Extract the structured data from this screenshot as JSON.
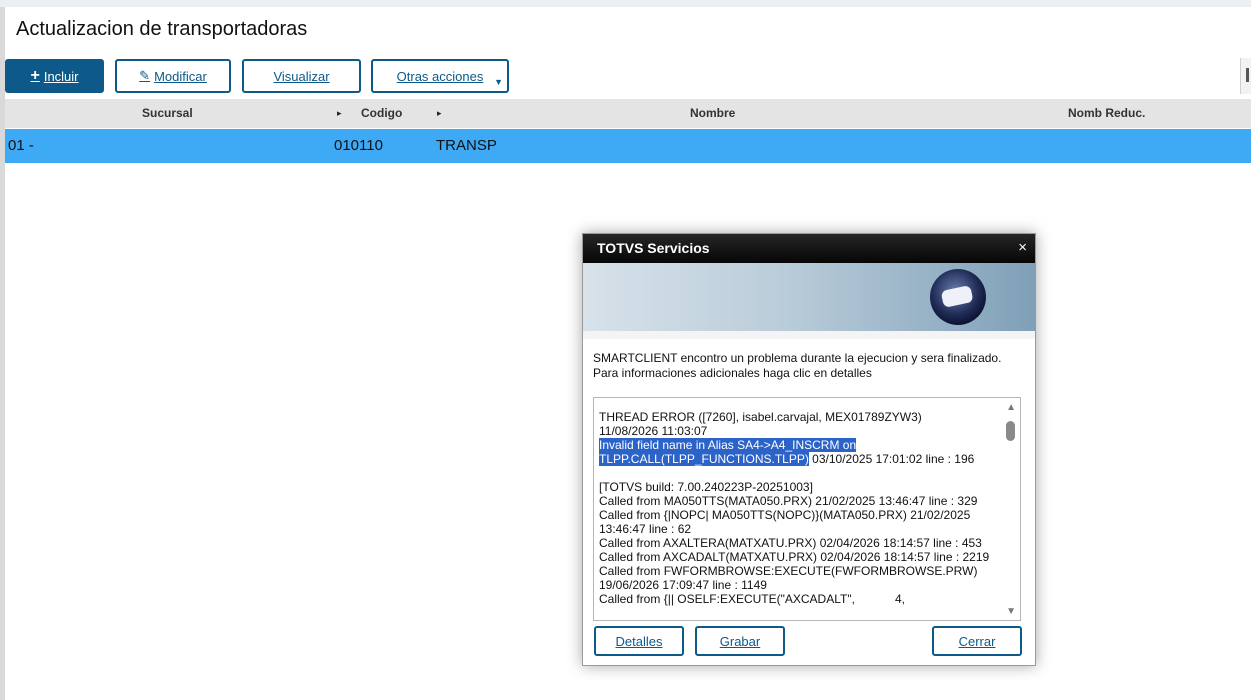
{
  "page": {
    "title": "Actualizacion de transportadoras"
  },
  "toolbar": {
    "incluir": "Incluir",
    "modificar": "Modificar",
    "visualizar": "Visualizar",
    "otras_acciones": "Otras acciones"
  },
  "grid": {
    "columns": [
      "Sucursal",
      "Codigo",
      "Nombre",
      "Nomb Reduc."
    ],
    "rows": [
      {
        "sucursal": "01 -",
        "codigo": "010110",
        "nombre": "TRANSP",
        "nomb_reduc": ""
      }
    ]
  },
  "dialog": {
    "title": "TOTVS Servicios",
    "message_line1": "SMARTCLIENT encontro un problema durante la ejecucion y sera finalizado.",
    "message_line2": "Para informaciones adicionales haga clic en detalles",
    "error": {
      "line1": "THREAD ERROR ([7260], isabel.carvajal, MEX01789ZYW3)",
      "line2": "11/08/2026 11:03:07",
      "selected1": "Invalid field name in Alias SA4->A4_INSCRM on",
      "selected2": "TLPP.CALL(TLPP_FUNCTIONS.TLPP)",
      "after_selected": " 03/10/2025 17:01:02 line : 196",
      "rest": "\n\n[TOTVS build: 7.00.240223P-20251003]\nCalled from MA050TTS(MATA050.PRX) 21/02/2025 13:46:47 line : 329\nCalled from {|NOPC| MA050TTS(NOPC)}(MATA050.PRX) 21/02/2025 13:46:47 line : 62\nCalled from AXALTERA(MATXATU.PRX) 02/04/2026 18:14:57 line : 453\nCalled from AXCADALT(MATXATU.PRX) 02/04/2026 18:14:57 line : 2219\nCalled from FWFORMBROWSE:EXECUTE(FWFORMBROWSE.PRW) 19/06/2026 17:09:47 line : 1149\nCalled from {|| OSELF:EXECUTE(\"AXCADALT\",            4,"
    },
    "buttons": {
      "detalles": "Detalles",
      "grabar": "Grabar",
      "cerrar": "Cerrar"
    },
    "close_glyph": "×"
  },
  "icons": {
    "plus": "+",
    "pencil": "✎",
    "caret": "▼",
    "sort_arrow": "▸",
    "scroll_up": "▲",
    "scroll_down": "▼"
  },
  "colors": {
    "primary": "#0d5a8a",
    "selected_row": "#3eaaf5",
    "selection": "#2b63c9"
  }
}
